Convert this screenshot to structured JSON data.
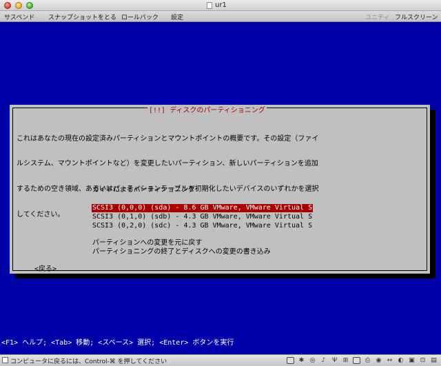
{
  "window": {
    "title": "ur1"
  },
  "toolbar": {
    "suspend": "サスペンド",
    "snapshot": "スナップショットをとる",
    "rollback": "ロールバック",
    "settings": "設定",
    "unity": "ユニティ",
    "fullscreen": "フルスクリーン"
  },
  "dialog": {
    "title": "[!!] ディスクのパーティショニング",
    "description": [
      "これはあなたの現在の設定済みパーティションとマウントポイントの概要です。その設定（ファイ",
      "ルシステム、マウントポイントなど）を変更したいパーティション、新しいパーティションを追加",
      "するための空き領域、あるいはパーティションテーブルを初期化したいデバイスのいずれかを選択",
      "してください。"
    ],
    "guided": "ガイドによるパーティショニング",
    "disks": [
      "SCSI3 (0,0,0) (sda) - 8.6 GB VMware, VMware Virtual S",
      "SCSI3 (0,1,0) (sdb) - 4.3 GB VMware, VMware Virtual S",
      "SCSI3 (0,2,0) (sdc) - 4.3 GB VMware, VMware Virtual S"
    ],
    "undo": "パーティションへの変更を元に戻す",
    "finish": "パーティショニングの終了とディスクへの変更の書き込み",
    "back": "<戻る>"
  },
  "helpbar": "<F1> ヘルプ; <Tab> 移動; <スペース> 選択; <Enter> ボタンを実行",
  "statusbar": {
    "text": "コンピュータに戻るには、Control-⌘ を押してください"
  },
  "icons": {
    "status": [
      "hdd-icon",
      "bluetooth-icon",
      "cd-icon",
      "audio-icon",
      "usb-icon",
      "network-icon",
      "floppy-icon",
      "printer-icon",
      "camera-icon",
      "arrows-icon",
      "sound-icon",
      "shared-folder-icon",
      "lock-icon",
      "keyboard-icon"
    ]
  },
  "colors": {
    "screen": "#0000aa",
    "dialog": "#c0c0c0",
    "highlight": "#aa0000",
    "title": "#aa0000"
  }
}
